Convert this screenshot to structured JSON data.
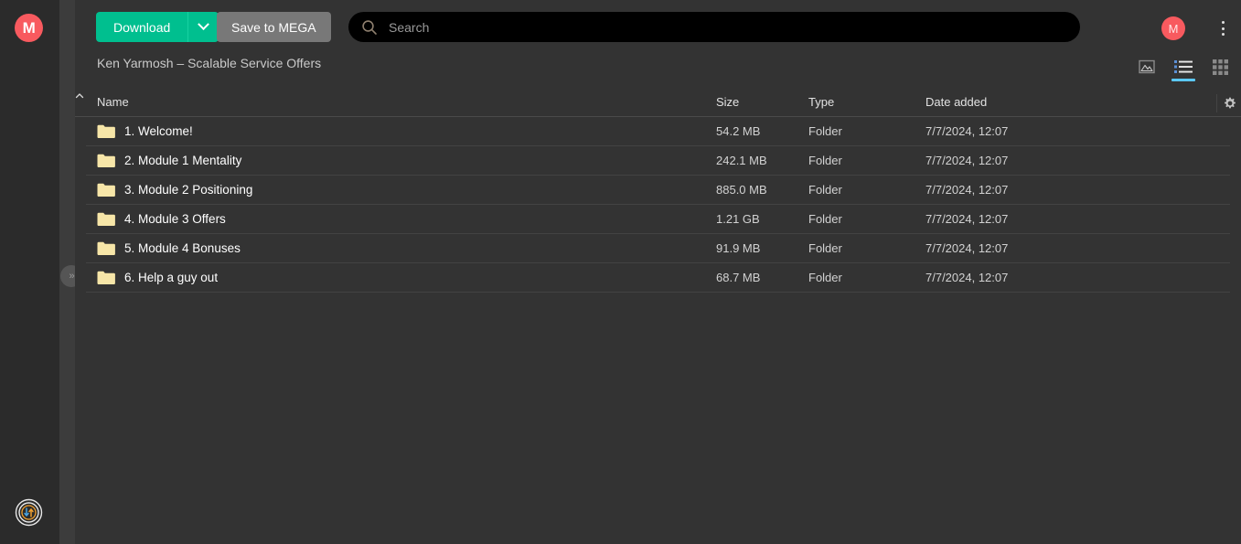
{
  "app": {
    "logo_letter": "M",
    "accent_green": "#00bf8f",
    "accent_red": "#f85a5f",
    "accent_blue": "#5bc8f5",
    "folder_color": "#f7e6a8"
  },
  "sidebar": {
    "logo_name": "mega-logo",
    "transfer_icon": "transfer-status-icon",
    "expand_handle_label": "»"
  },
  "toolbar": {
    "download_label": "Download",
    "download_caret_icon": "chevron-down-icon",
    "save_label": "Save to MEGA",
    "avatar_letter": "M",
    "menu_icon": "kebab-menu-icon"
  },
  "search": {
    "placeholder": "Search",
    "value": "",
    "icon": "search-icon"
  },
  "breadcrumb": {
    "path": "Ken Yarmosh – Scalable Service Offers"
  },
  "views": [
    {
      "name": "gallery-view",
      "icon": "image-icon",
      "active": false
    },
    {
      "name": "list-view",
      "icon": "list-icon",
      "active": true
    },
    {
      "name": "grid-view",
      "icon": "grid-icon",
      "active": false
    }
  ],
  "table": {
    "columns": {
      "name": "Name",
      "size": "Size",
      "type": "Type",
      "date": "Date added"
    },
    "sort": {
      "column": "name",
      "direction": "asc",
      "icon": "caret-up-icon"
    },
    "settings_icon": "gear-icon",
    "rows": [
      {
        "name": "1. Welcome!",
        "size": "54.2 MB",
        "type": "Folder",
        "date": "7/7/2024, 12:07"
      },
      {
        "name": "2. Module 1 Mentality",
        "size": "242.1 MB",
        "type": "Folder",
        "date": "7/7/2024, 12:07"
      },
      {
        "name": "3. Module 2 Positioning",
        "size": "885.0 MB",
        "type": "Folder",
        "date": "7/7/2024, 12:07"
      },
      {
        "name": "4. Module 3 Offers",
        "size": "1.21 GB",
        "type": "Folder",
        "date": "7/7/2024, 12:07"
      },
      {
        "name": "5. Module 4 Bonuses",
        "size": "91.9 MB",
        "type": "Folder",
        "date": "7/7/2024, 12:07"
      },
      {
        "name": "6. Help a guy out",
        "size": "68.7 MB",
        "type": "Folder",
        "date": "7/7/2024, 12:07"
      }
    ]
  }
}
